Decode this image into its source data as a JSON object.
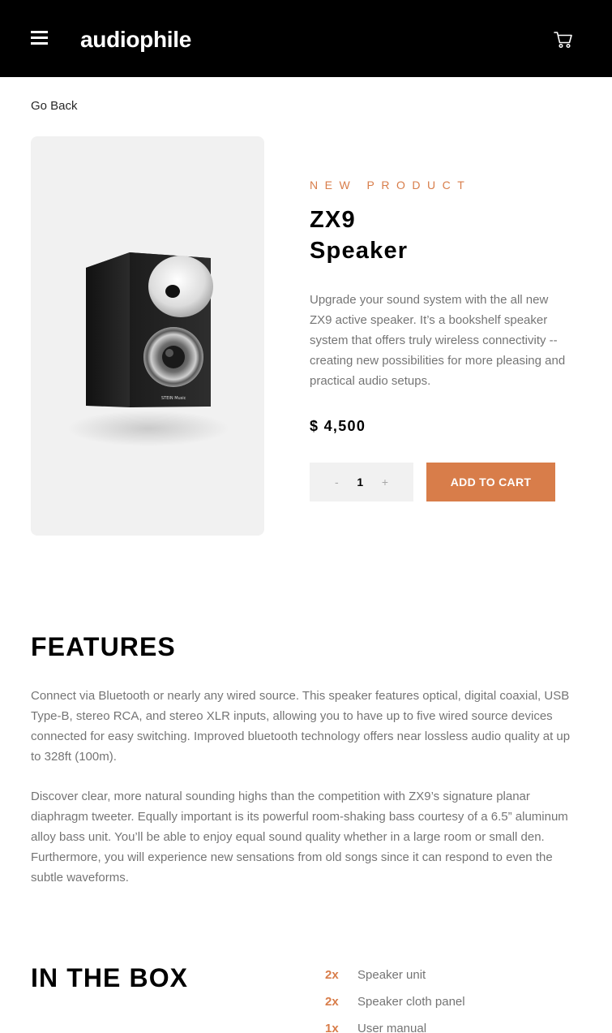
{
  "header": {
    "logo": "audiophile",
    "menu_icon": "hamburger-menu-icon",
    "cart_icon": "shopping-cart-icon"
  },
  "nav": {
    "go_back": "Go Back"
  },
  "product": {
    "overline": "NEW PRODUCT",
    "title_line1": "ZX9",
    "title_line2": "Speaker",
    "description": "Upgrade your sound system with the all new ZX9 active speaker. It’s a bookshelf speaker system that offers truly wireless connectivity -- creating new possibilities for more pleasing and practical audio setups.",
    "price": "$ 4,500",
    "image_brand_text": "STEIN Music",
    "quantity": {
      "decrement": "-",
      "value": "1",
      "increment": "+"
    },
    "add_to_cart_label": "ADD TO CART"
  },
  "features": {
    "title": "FEATURES",
    "paragraph1": "Connect via Bluetooth or nearly any wired source. This speaker features optical, digital coaxial, USB Type-B, stereo RCA, and stereo XLR inputs, allowing you to have up to five wired source devices connected for easy switching. Improved bluetooth technology offers near lossless audio quality at up to 328ft (100m).",
    "paragraph2": "Discover clear, more natural sounding highs than the competition with ZX9’s signature planar diaphragm tweeter. Equally important is its powerful room-shaking bass courtesy of a 6.5” aluminum alloy bass unit. You’ll be able to enjoy equal sound quality whether in a large room or small den. Furthermore, you will experience new sensations from old songs since it can respond to even the subtle waveforms."
  },
  "in_the_box": {
    "title": "IN THE BOX",
    "items": [
      {
        "qty": "2x",
        "name": "Speaker unit"
      },
      {
        "qty": "2x",
        "name": "Speaker cloth panel"
      },
      {
        "qty": "1x",
        "name": "User manual"
      }
    ]
  },
  "colors": {
    "accent": "#d87d4a",
    "header_bg": "#000000",
    "light_gray": "#f1f1f1"
  }
}
